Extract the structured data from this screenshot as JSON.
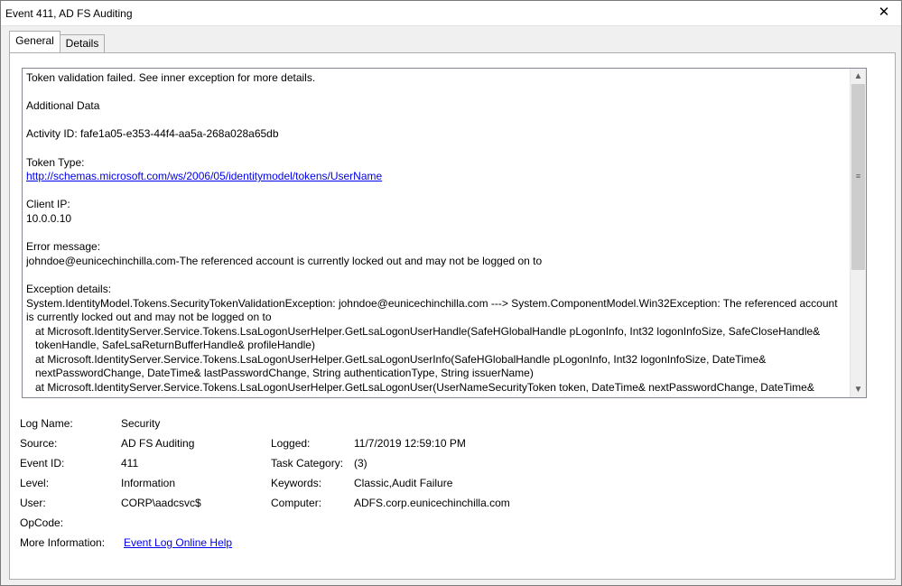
{
  "window": {
    "title": "Event 411, AD FS Auditing",
    "close_glyph": "✕"
  },
  "tabs": [
    {
      "label": "General",
      "active": true
    },
    {
      "label": "Details",
      "active": false
    }
  ],
  "message": {
    "line1": "Token validation failed. See inner exception for more details.",
    "additional_data": "Additional Data",
    "activity_id": "Activity ID: fafe1a05-e353-44f4-aa5a-268a028a65db",
    "token_type_label": "Token Type:",
    "token_type_link": "http://schemas.microsoft.com/ws/2006/05/identitymodel/tokens/UserName",
    "client_ip_label": "Client IP:",
    "client_ip_value": "10.0.0.10",
    "error_message_label": "Error message:",
    "error_message_value": "johndoe@eunicechinchilla.com-The referenced account is currently locked out and may not be logged on to",
    "exception_label": "Exception details:",
    "exception_lines": [
      "System.IdentityModel.Tokens.SecurityTokenValidationException: johndoe@eunicechinchilla.com ---> System.ComponentModel.Win32Exception: The referenced account is currently locked out and may not be logged on to",
      "at Microsoft.IdentityServer.Service.Tokens.LsaLogonUserHelper.GetLsaLogonUserHandle(SafeHGlobalHandle pLogonInfo, Int32 logonInfoSize, SafeCloseHandle& tokenHandle, SafeLsaReturnBufferHandle& profileHandle)",
      "at Microsoft.IdentityServer.Service.Tokens.LsaLogonUserHelper.GetLsaLogonUserInfo(SafeHGlobalHandle pLogonInfo, Int32 logonInfoSize, DateTime& nextPasswordChange, DateTime& lastPasswordChange, String authenticationType, String issuerName)",
      "at Microsoft.IdentityServer.Service.Tokens.LsaLogonUserHelper.GetLsaLogonUser(UserNameSecurityToken token, DateTime& nextPasswordChange, DateTime&"
    ]
  },
  "properties": {
    "log_name_label": "Log Name:",
    "log_name_value": "Security",
    "source_label": "Source:",
    "source_value": "AD FS Auditing",
    "logged_label": "Logged:",
    "logged_value": "11/7/2019 12:59:10 PM",
    "event_id_label": "Event ID:",
    "event_id_value": "411",
    "task_category_label": "Task Category:",
    "task_category_value": "(3)",
    "level_label": "Level:",
    "level_value": "Information",
    "keywords_label": "Keywords:",
    "keywords_value": "Classic,Audit Failure",
    "user_label": "User:",
    "user_value": "CORP\\aadcsvc$",
    "computer_label": "Computer:",
    "computer_value": "ADFS.corp.eunicechinchilla.com",
    "opcode_label": "OpCode:",
    "opcode_value": "",
    "more_info_label": "More Information:",
    "more_info_link": "Event Log Online Help"
  },
  "icons": {
    "scroll_up": "▲",
    "scroll_down": "▼",
    "scroll_grip": "≡"
  }
}
